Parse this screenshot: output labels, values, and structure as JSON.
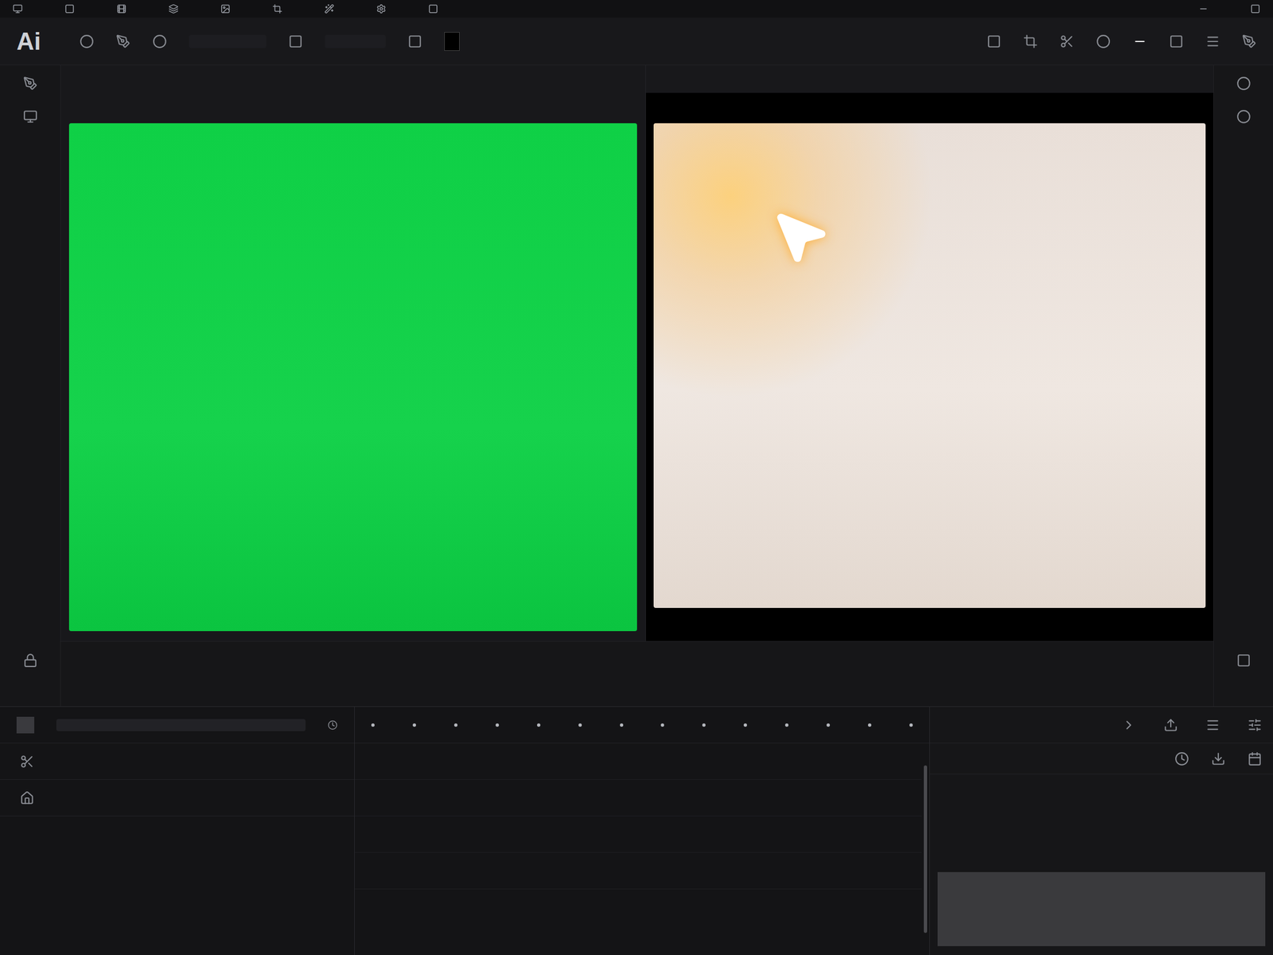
{
  "app": {
    "logo": "Ai"
  },
  "viewer": {
    "panels": [
      {
        "kind": "source"
      },
      {
        "kind": "result"
      }
    ]
  }
}
